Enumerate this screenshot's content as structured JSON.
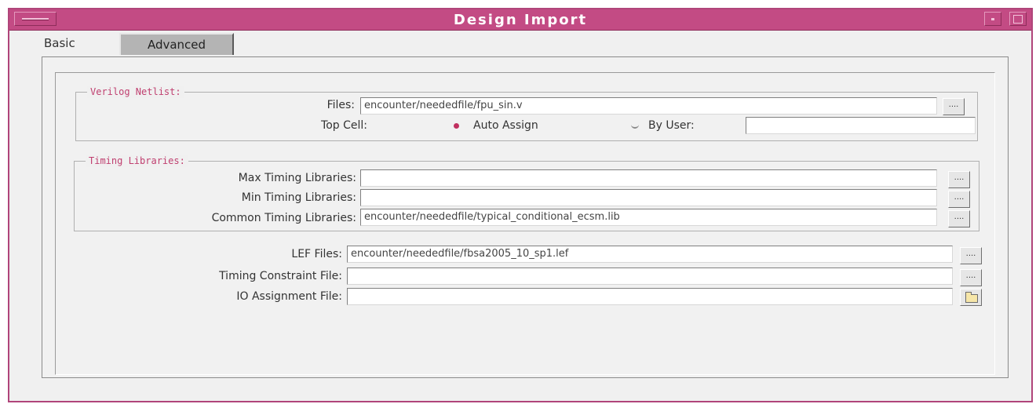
{
  "window": {
    "title": "Design Import"
  },
  "tabs": [
    {
      "label": "Basic",
      "active": false
    },
    {
      "label": "Advanced",
      "active": true
    }
  ],
  "verilog": {
    "legend": "Verilog Netlist:",
    "files_label": "Files:",
    "files_value": "encounter/neededfile/fpu_sin.v",
    "browse_label": "....",
    "top_cell_label": "Top Cell:",
    "auto_assign_label": "Auto Assign",
    "by_user_label": "By User:",
    "by_user_value": ""
  },
  "timing": {
    "legend": "Timing Libraries:",
    "max_label": "Max Timing Libraries:",
    "max_value": "",
    "min_label": "Min Timing Libraries:",
    "min_value": "",
    "common_label": "Common Timing Libraries:",
    "common_value": "encounter/neededfile/typical_conditional_ecsm.lib",
    "browse_label": "...."
  },
  "files": {
    "lef_label": "LEF Files:",
    "lef_value": "encounter/neededfile/fbsa2005_10_sp1.lef",
    "timing_constraint_label": "Timing Constraint File:",
    "timing_constraint_value": "",
    "io_assignment_label": "IO Assignment File:",
    "io_assignment_value": "",
    "browse_label": "...."
  }
}
